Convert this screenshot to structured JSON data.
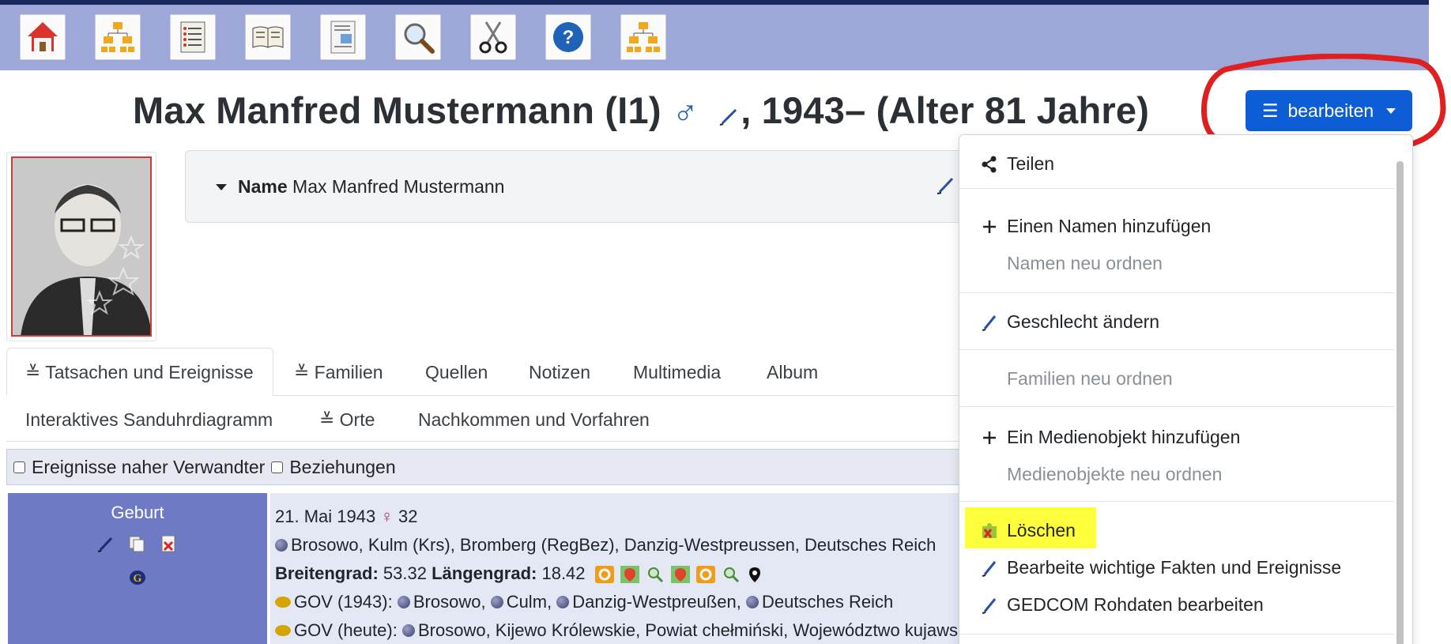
{
  "toolbar": {
    "buttons": [
      {
        "name": "home-icon"
      },
      {
        "name": "pedigree-icon"
      },
      {
        "name": "list-icon"
      },
      {
        "name": "book-icon"
      },
      {
        "name": "report-icon"
      },
      {
        "name": "search-icon"
      },
      {
        "name": "clippings-icon"
      },
      {
        "name": "help-icon"
      },
      {
        "name": "tree-chart-icon"
      }
    ]
  },
  "header": {
    "name": "Max Manfred Mustermann (I1)",
    "sex_symbol": "♂",
    "life": ", 1943– (Alter 81 Jahre)",
    "edit_button": "bearbeiten",
    "edit_button_icon": "☰"
  },
  "name_panel": {
    "label": "Name",
    "value": "Max Manfred Mustermann"
  },
  "tabs": [
    {
      "label": "Tatsachen und Ereignisse",
      "icon": "≚"
    },
    {
      "label": "Familien",
      "icon": "≚"
    },
    {
      "label": "Quellen"
    },
    {
      "label": "Notizen"
    },
    {
      "label": "Multimedia"
    },
    {
      "label": "Album"
    },
    {
      "label": "Interaktives Sanduhrdiagramm"
    },
    {
      "label": "Orte",
      "icon": "≚"
    },
    {
      "label": "Nachkommen und Vorfahren"
    }
  ],
  "filters": {
    "relatives": "Ereignisse naher Verwandter",
    "relations": "Beziehungen"
  },
  "event": {
    "type": "Geburt",
    "date": "21. Mai 1943",
    "mother_symbol": "♀",
    "mother_age": "32",
    "place": "Brosowo, Kulm (Krs), Bromberg (RegBez), Danzig-Westpreussen, Deutsches Reich",
    "lat_label": "Breitengrad:",
    "lat": "53.32",
    "lon_label": "Längengrad:",
    "lon": "18.42",
    "gov1_label": "GOV (1943):",
    "gov1_places": [
      "Brosowo,",
      "Culm,",
      "Danzig-Westpreußen,",
      "Deutsches Reich"
    ],
    "gov2_label": "GOV (heute):",
    "gov2_places": [
      "Brosowo, Kijewo Królewskie, Powiat chełmiński, Województwo kujawsko-pomorskie"
    ]
  },
  "dropdown": {
    "share": "Teilen",
    "add_name": "Einen Namen hinzufügen",
    "reorder_names": "Namen neu ordnen",
    "change_sex": "Geschlecht ändern",
    "reorder_families": "Familien neu ordnen",
    "add_media": "Ein Medienobjekt hinzufügen",
    "reorder_media": "Medienobjekte neu ordnen",
    "delete": "Löschen",
    "edit_facts": "Bearbeite wichtige Fakten und Ereignisse",
    "edit_gedcom": "GEDCOM Rohdaten bearbeiten"
  },
  "colors": {
    "toolbar_bg": "#9ea8d8",
    "primary": "#0d5ed6",
    "event_label_bg": "#6e7bc4",
    "highlight": "#ffff3c",
    "annotation_red": "#e02020"
  }
}
